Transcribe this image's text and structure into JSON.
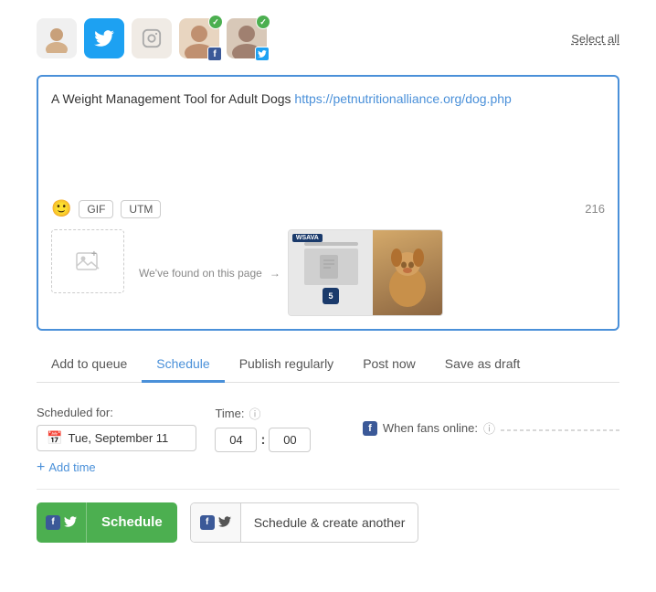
{
  "accounts": [
    {
      "id": "person1",
      "type": "photo",
      "selected": false,
      "color": "#e8c99a"
    },
    {
      "id": "twitter1",
      "type": "twitter",
      "selected": false
    },
    {
      "id": "instagram1",
      "type": "instagram",
      "selected": false,
      "color": "#e0d0c0"
    },
    {
      "id": "facebook1",
      "type": "facebook-photo",
      "selected": true
    },
    {
      "id": "twitter2",
      "type": "twitter-photo",
      "selected": true
    }
  ],
  "select_all_label": "Select all",
  "editor": {
    "text_prefix": "A Weight Management Tool for Adult Dogs ",
    "link": "https://petnutritionalliance.org/dog.php",
    "char_count": "216",
    "gif_label": "GIF",
    "utm_label": "UTM",
    "add_image_label": "＋",
    "preview_label": "We've found on this page",
    "preview_brand": "WSAVA"
  },
  "tabs": [
    {
      "id": "add-to-queue",
      "label": "Add to queue",
      "active": false
    },
    {
      "id": "schedule",
      "label": "Schedule",
      "active": true
    },
    {
      "id": "publish-regularly",
      "label": "Publish regularly",
      "active": false
    },
    {
      "id": "post-now",
      "label": "Post now",
      "active": false
    },
    {
      "id": "save-as-draft",
      "label": "Save as draft",
      "active": false
    }
  ],
  "schedule_form": {
    "scheduled_for_label": "Scheduled for:",
    "date_value": "Tue, September 11",
    "time_label": "Time:",
    "hour_value": "04",
    "minute_value": "00",
    "fans_online_label": "When fans online:",
    "add_time_label": "Add time"
  },
  "buttons": {
    "schedule_label": "Schedule",
    "schedule_another_label": "Schedule & create another"
  }
}
